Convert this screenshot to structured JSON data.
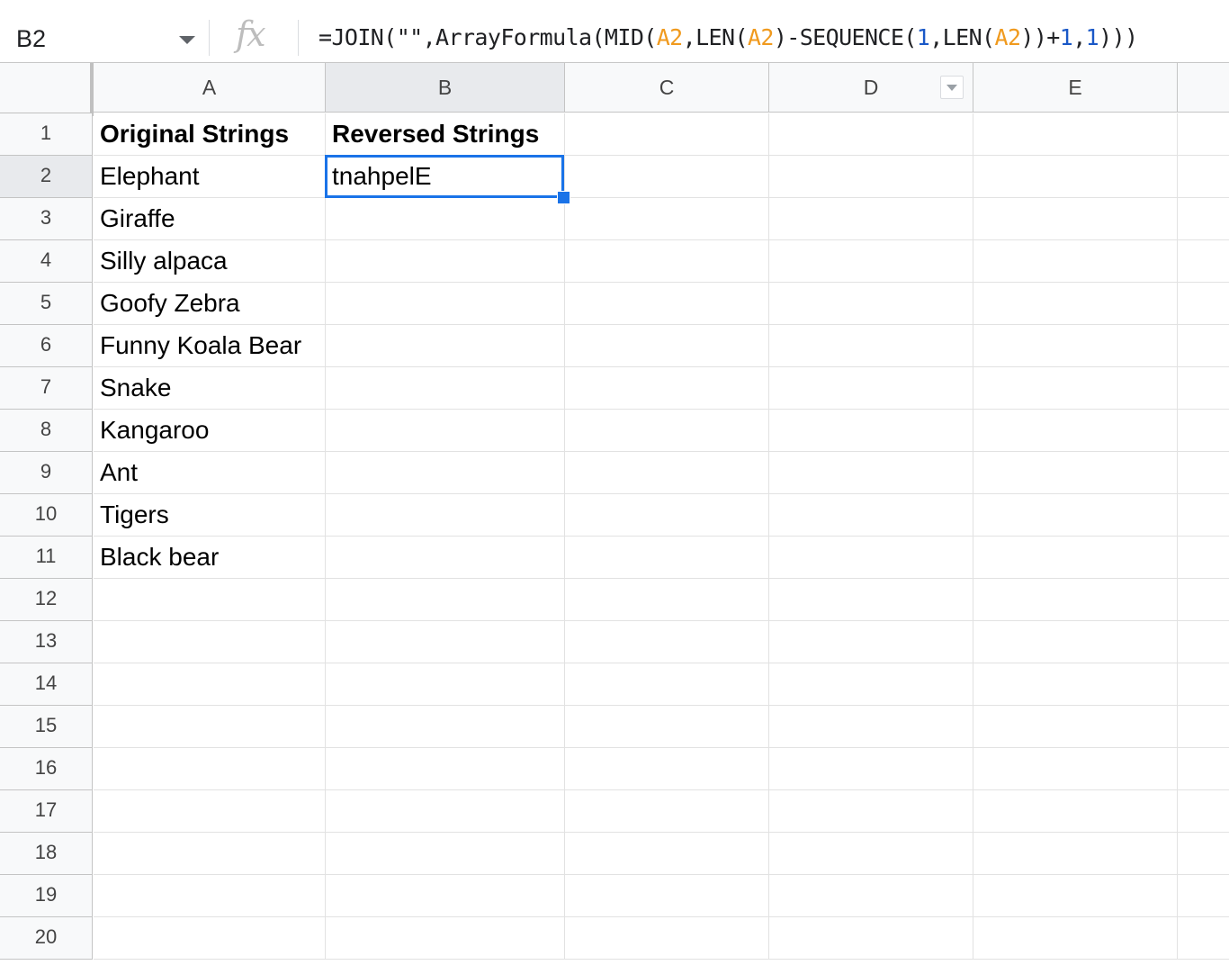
{
  "formula_bar": {
    "name_box": "B2",
    "fx_label": "fx",
    "formula_parts": [
      {
        "t": "=JOIN(\"\",ArrayFormula(MID(",
        "c": "text"
      },
      {
        "t": "A2",
        "c": "ref"
      },
      {
        "t": ",LEN(",
        "c": "text"
      },
      {
        "t": "A2",
        "c": "ref"
      },
      {
        "t": ")-SEQUENCE(",
        "c": "text"
      },
      {
        "t": "1",
        "c": "num"
      },
      {
        "t": ",LEN(",
        "c": "text"
      },
      {
        "t": "A2",
        "c": "ref"
      },
      {
        "t": "))+",
        "c": "text"
      },
      {
        "t": "1",
        "c": "num"
      },
      {
        "t": ",",
        "c": "text"
      },
      {
        "t": "1",
        "c": "num"
      },
      {
        "t": ")))",
        "c": "text"
      }
    ]
  },
  "columns": [
    "A",
    "B",
    "C",
    "D",
    "E"
  ],
  "selected_column": "B",
  "selected_row": "2",
  "rows": [
    "1",
    "2",
    "3",
    "4",
    "5",
    "6",
    "7",
    "8",
    "9",
    "10",
    "11",
    "12",
    "13",
    "14",
    "15",
    "16",
    "17",
    "18",
    "19",
    "20"
  ],
  "cells": {
    "A": [
      "Original Strings",
      "Elephant",
      "Giraffe",
      "Silly alpaca",
      "Goofy Zebra",
      "Funny Koala Bear",
      "Snake",
      "Kangaroo",
      "Ant",
      "Tigers",
      "Black bear"
    ],
    "B": [
      "Reversed Strings",
      "tnahpelE"
    ]
  },
  "colors": {
    "selection": "#1a73e8",
    "formula_ref": "#f09a1e",
    "formula_number": "#1a58c7"
  }
}
